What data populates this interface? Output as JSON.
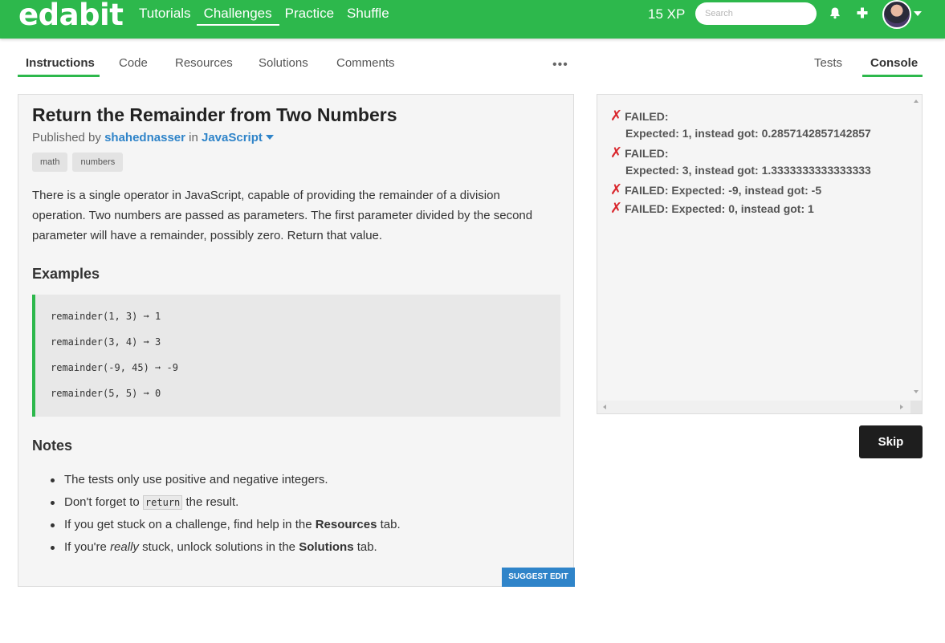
{
  "app": {
    "logo": "edabit"
  },
  "nav": {
    "links": [
      "Tutorials",
      "Challenges",
      "Practice",
      "Shuffle"
    ],
    "xp": "15 XP",
    "search_placeholder": "Search",
    "icons": [
      "bell-icon",
      "plus-icon",
      "avatar",
      "chevron-down-icon"
    ]
  },
  "tabs": {
    "left": [
      "Instructions",
      "Code",
      "Resources",
      "Solutions",
      "Comments"
    ],
    "more": "•••",
    "right": [
      "Tests",
      "Console"
    ],
    "active_left": "Instructions",
    "active_right": "Console"
  },
  "challenge": {
    "title": "Return the Remainder from Two Numbers",
    "published_by_prefix": "Published by",
    "author": "shahednasser",
    "in_word": "in",
    "language": "JavaScript",
    "tags": [
      "math",
      "numbers"
    ],
    "description": "There is a single operator in JavaScript, capable of providing the remainder of a division operation. Two numbers are passed as parameters. The first parameter divided by the second parameter will have a remainder, possibly zero. Return that value.",
    "examples_heading": "Examples",
    "examples": [
      "remainder(1, 3) ➞ 1",
      "remainder(3, 4) ➞ 3",
      "remainder(-9, 45) ➞ -9",
      "remainder(5, 5) ➞ 0"
    ],
    "notes_heading": "Notes",
    "notes": {
      "n1": "The tests only use positive and negative integers.",
      "n2_pre": "Don't forget to",
      "n2_code": "return",
      "n2_post": "the result.",
      "n3_pre": "If you get stuck on a challenge, find help in the",
      "n3_bold": "Resources",
      "n3_post": "tab.",
      "n4_pre": "If you're",
      "n4_em": "really",
      "n4_mid": "stuck, unlock solutions in the",
      "n4_bold": "Solutions",
      "n4_post": "tab."
    },
    "suggest_edit": "SUGGEST EDIT"
  },
  "console": {
    "mark": "✗",
    "lines": [
      {
        "mark": true,
        "text": "FAILED:"
      },
      {
        "mark": false,
        "text": "Expected: 1, instead got: 0.2857142857142857"
      },
      {
        "mark": true,
        "text": "FAILED:"
      },
      {
        "mark": false,
        "text": "Expected: 3, instead got: 1.3333333333333333"
      },
      {
        "mark": true,
        "text": "FAILED: Expected: -9, instead got: -5"
      },
      {
        "mark": true,
        "text": "FAILED: Expected: 0, instead got: 1"
      }
    ]
  },
  "actions": {
    "skip": "Skip"
  },
  "colors": {
    "brand": "#2db84c",
    "link": "#2f84c9",
    "error": "#d9262c",
    "dark_button": "#1e1e1e"
  }
}
